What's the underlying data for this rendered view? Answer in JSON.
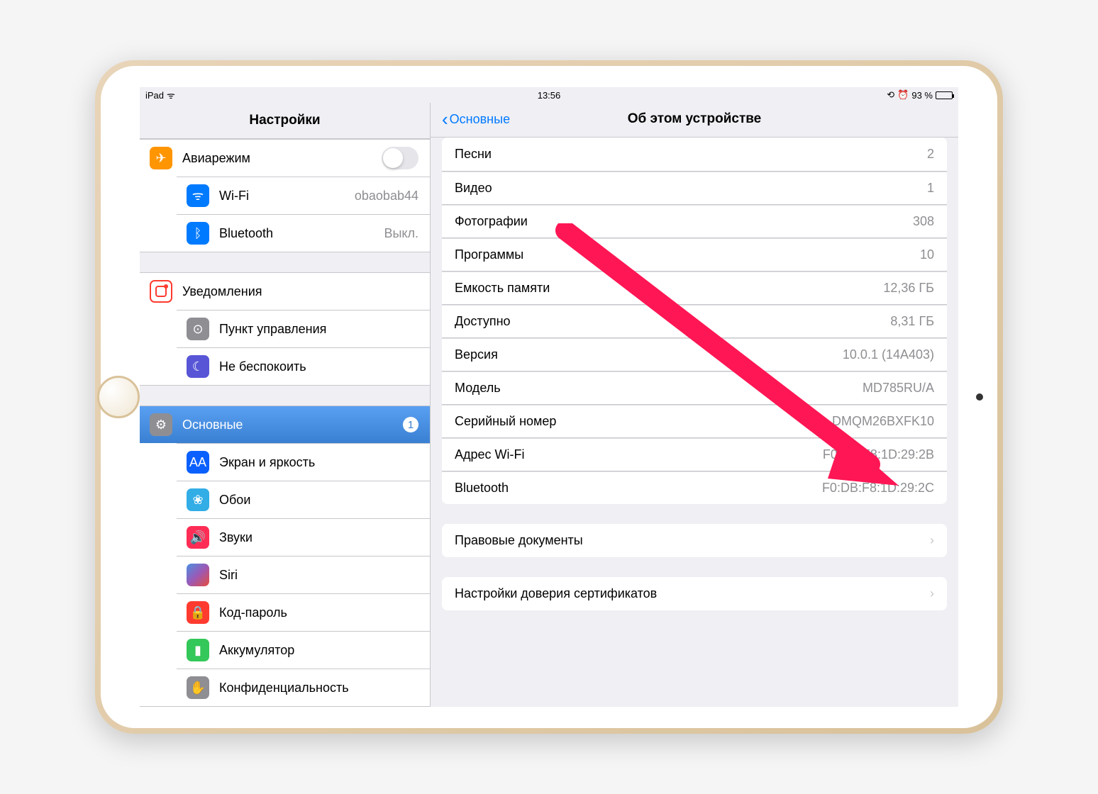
{
  "status": {
    "device": "iPad",
    "time": "13:56",
    "battery_pct": "93 %"
  },
  "sidebar": {
    "title": "Настройки",
    "groups": [
      [
        {
          "id": "airplane",
          "label": "Авиарежим",
          "icon_bg": "bg-orange",
          "glyph": "✈",
          "toggle": true
        },
        {
          "id": "wifi",
          "label": "Wi-Fi",
          "icon_bg": "bg-blue",
          "glyph": "ᯤ",
          "value": "obaobab44"
        },
        {
          "id": "bluetooth",
          "label": "Bluetooth",
          "icon_bg": "bg-blue",
          "glyph": "ᛒ",
          "value": "Выкл."
        }
      ],
      [
        {
          "id": "notifications",
          "label": "Уведомления",
          "icon_bg": "bg-notif",
          "glyph": ""
        },
        {
          "id": "control-center",
          "label": "Пункт управления",
          "icon_bg": "bg-gray",
          "glyph": "⊙"
        },
        {
          "id": "dnd",
          "label": "Не беспокоить",
          "icon_bg": "bg-purple",
          "glyph": "☾"
        }
      ],
      [
        {
          "id": "general",
          "label": "Основные",
          "icon_bg": "bg-gray",
          "glyph": "⚙",
          "badge": "1",
          "selected": true
        },
        {
          "id": "display",
          "label": "Экран и яркость",
          "icon_bg": "bg-darkblue",
          "glyph": "AA"
        },
        {
          "id": "wallpaper",
          "label": "Обои",
          "icon_bg": "bg-cyan",
          "glyph": "❀"
        },
        {
          "id": "sounds",
          "label": "Звуки",
          "icon_bg": "bg-pink",
          "glyph": "🔊"
        },
        {
          "id": "siri",
          "label": "Siri",
          "icon_bg": "bg-siri",
          "glyph": ""
        },
        {
          "id": "passcode",
          "label": "Код-пароль",
          "icon_bg": "bg-red",
          "glyph": "🔒"
        },
        {
          "id": "battery",
          "label": "Аккумулятор",
          "icon_bg": "bg-green",
          "glyph": "▮"
        },
        {
          "id": "privacy",
          "label": "Конфиденциальность",
          "icon_bg": "bg-gray",
          "glyph": "✋"
        }
      ]
    ]
  },
  "main": {
    "back_label": "Основные",
    "title": "Об этом устройстве",
    "info": [
      {
        "label": "Песни",
        "value": "2"
      },
      {
        "label": "Видео",
        "value": "1"
      },
      {
        "label": "Фотографии",
        "value": "308"
      },
      {
        "label": "Программы",
        "value": "10"
      },
      {
        "label": "Емкость памяти",
        "value": "12,36 ГБ"
      },
      {
        "label": "Доступно",
        "value": "8,31 ГБ"
      },
      {
        "label": "Версия",
        "value": "10.0.1 (14A403)"
      },
      {
        "label": "Модель",
        "value": "MD785RU/A"
      },
      {
        "label": "Серийный номер",
        "value": "DMQM26BXFK10"
      },
      {
        "label": "Адрес Wi-Fi",
        "value": "F0:DB:F8:1D:29:2B"
      },
      {
        "label": "Bluetooth",
        "value": "F0:DB:F8:1D:29:2C"
      }
    ],
    "legal": {
      "label": "Правовые документы"
    },
    "cert": {
      "label": "Настройки доверия сертификатов"
    }
  },
  "arrow_color": "#ff1654"
}
